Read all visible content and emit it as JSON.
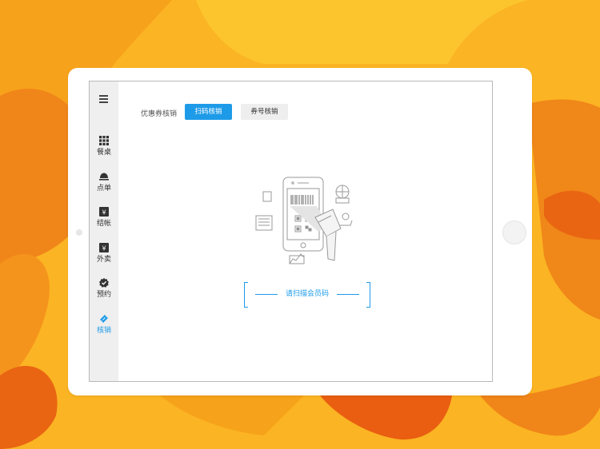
{
  "sidebar": {
    "menu_icon": "hamburger-menu-icon",
    "items": [
      {
        "label": "餐桌",
        "icon": "grid-icon"
      },
      {
        "label": "点单",
        "icon": "bell-icon"
      },
      {
        "label": "结帐",
        "icon": "yen-icon"
      },
      {
        "label": "外卖",
        "icon": "yen-icon"
      },
      {
        "label": "预约",
        "icon": "verified-icon"
      },
      {
        "label": "核销",
        "icon": "ticket-icon"
      }
    ],
    "active_index": 5
  },
  "main": {
    "section_label": "优惠券核销",
    "tabs": [
      {
        "label": "扫码核销",
        "active": true
      },
      {
        "label": "券号核销",
        "active": false
      }
    ],
    "illustration": "scanner-phone-icon",
    "scan_prompt": "请扫描会员码"
  },
  "colors": {
    "accent": "#1E9BE8",
    "background": "#FBB423",
    "sidebar_bg": "#EFEFEF"
  }
}
